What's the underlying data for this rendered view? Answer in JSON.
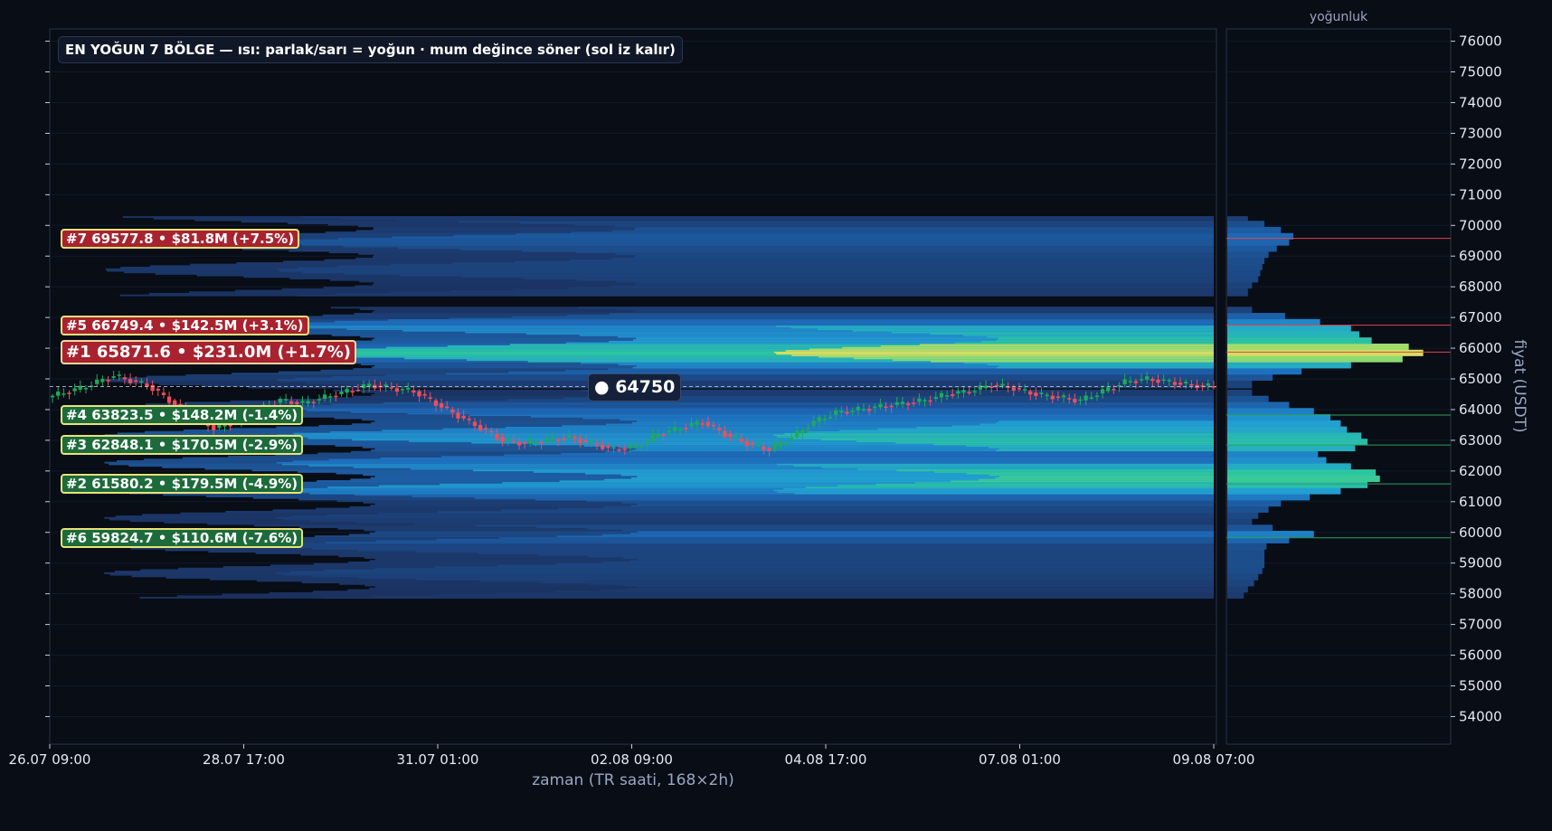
{
  "chart_title": "EN YOĞUN 7 BÖLGE — ısı: parlak/sarı = yoğun · mum değince söner (sol iz kalır)",
  "profile_title": "yoğunluk",
  "current_price_label": "● 64750",
  "colors": {
    "background": "#080d16",
    "bull_candle": "#1faa59",
    "bear_candle": "#ef4e5c",
    "heat_low": "#1b2c58",
    "heat_mid": "#1e8fd0",
    "heat_high": "#2cc7a0",
    "heat_top": "#f3e05a",
    "label_red": "#a8232f",
    "label_green": "#1d6b3a"
  },
  "zone_labels": [
    {
      "rank": "#7",
      "text": "#7  69577.8  •  $81.8M  (+7.5%)",
      "color": "red"
    },
    {
      "rank": "#5",
      "text": "#5  66749.4  •  $142.5M  (+3.1%)",
      "color": "red"
    },
    {
      "rank": "#1",
      "text": "#1  65871.6  •  $231.0M  (+1.7%)",
      "color": "red"
    },
    {
      "rank": "#4",
      "text": "#4  63823.5  •  $148.2M  (-1.4%)",
      "color": "green"
    },
    {
      "rank": "#3",
      "text": "#3  62848.1  •  $170.5M  (-2.9%)",
      "color": "green"
    },
    {
      "rank": "#2",
      "text": "#2  61580.2  •  $179.5M  (-4.9%)",
      "color": "green"
    },
    {
      "rank": "#6",
      "text": "#6  59824.7  •  $110.6M  (-7.6%)",
      "color": "green"
    }
  ],
  "chart_data": {
    "type": "heatmap",
    "title": "EN YOĞUN 7 BÖLGE — ısı: parlak/sarı = yoğun · mum değince söner (sol iz kalır)",
    "xlabel": "zaman (TR saati, 168×2h)",
    "ylabel": "fiyat (USDT)",
    "x_ticks": [
      "26.07 09:00",
      "28.07 17:00",
      "31.07 01:00",
      "02.08 09:00",
      "04.08 17:00",
      "07.08 01:00",
      "09.08 07:00"
    ],
    "y_ticks": [
      "54000",
      "55000",
      "56000",
      "57000",
      "58000",
      "59000",
      "60000",
      "61000",
      "62000",
      "63000",
      "64000",
      "65000",
      "66000",
      "67000",
      "68000",
      "69000",
      "70000",
      "71000",
      "72000",
      "73000",
      "74000",
      "75000",
      "76000"
    ],
    "ylim": [
      53100,
      76400
    ],
    "candle_count": 168,
    "current_price": 64750,
    "zones": [
      {
        "rank": 7,
        "price": 69577.8,
        "liquidity_musd": 81.8,
        "change_pct": 7.5
      },
      {
        "rank": 5,
        "price": 66749.4,
        "liquidity_musd": 142.5,
        "change_pct": 3.1
      },
      {
        "rank": 1,
        "price": 65871.6,
        "liquidity_musd": 231.0,
        "change_pct": 1.7
      },
      {
        "rank": 4,
        "price": 63823.5,
        "liquidity_musd": 148.2,
        "change_pct": -1.4
      },
      {
        "rank": 3,
        "price": 62848.1,
        "liquidity_musd": 170.5,
        "change_pct": -2.9
      },
      {
        "rank": 2,
        "price": 61580.2,
        "liquidity_musd": 179.5,
        "change_pct": -4.9
      },
      {
        "rank": 6,
        "price": 59824.7,
        "liquidity_musd": 110.6,
        "change_pct": -7.6
      }
    ],
    "price_path": [
      [
        0,
        64400
      ],
      [
        6,
        64700
      ],
      [
        12,
        65100
      ],
      [
        18,
        64800
      ],
      [
        22,
        64300
      ],
      [
        26,
        63800
      ],
      [
        30,
        63400
      ],
      [
        34,
        63600
      ],
      [
        38,
        64000
      ],
      [
        42,
        64300
      ],
      [
        46,
        64200
      ],
      [
        50,
        64400
      ],
      [
        54,
        64600
      ],
      [
        58,
        64800
      ],
      [
        62,
        64700
      ],
      [
        66,
        64600
      ],
      [
        70,
        64200
      ],
      [
        74,
        63800
      ],
      [
        78,
        63400
      ],
      [
        82,
        63000
      ],
      [
        86,
        62900
      ],
      [
        90,
        63000
      ],
      [
        94,
        63100
      ],
      [
        98,
        62900
      ],
      [
        102,
        62700
      ],
      [
        106,
        62800
      ],
      [
        110,
        63200
      ],
      [
        114,
        63400
      ],
      [
        118,
        63600
      ],
      [
        122,
        63200
      ],
      [
        126,
        62900
      ],
      [
        130,
        62700
      ],
      [
        134,
        63100
      ],
      [
        138,
        63600
      ],
      [
        142,
        63900
      ],
      [
        146,
        64000
      ],
      [
        150,
        64100
      ],
      [
        154,
        64200
      ],
      [
        158,
        64300
      ],
      [
        162,
        64500
      ],
      [
        166,
        64600
      ],
      [
        170,
        64800
      ],
      [
        174,
        64700
      ],
      [
        178,
        64500
      ],
      [
        182,
        64400
      ],
      [
        186,
        64300
      ],
      [
        190,
        64600
      ],
      [
        194,
        64900
      ],
      [
        198,
        65000
      ],
      [
        202,
        64900
      ],
      [
        206,
        64800
      ],
      [
        210,
        64750
      ]
    ],
    "density_profile": [
      [
        57900,
        0.08
      ],
      [
        58100,
        0.1
      ],
      [
        58300,
        0.13
      ],
      [
        58500,
        0.15
      ],
      [
        58700,
        0.17
      ],
      [
        58900,
        0.18
      ],
      [
        59100,
        0.18
      ],
      [
        59300,
        0.18
      ],
      [
        59500,
        0.19
      ],
      [
        59700,
        0.3
      ],
      [
        59900,
        0.42
      ],
      [
        60100,
        0.22
      ],
      [
        60300,
        0.12
      ],
      [
        60500,
        0.15
      ],
      [
        60700,
        0.2
      ],
      [
        60900,
        0.26
      ],
      [
        61100,
        0.4
      ],
      [
        61300,
        0.55
      ],
      [
        61500,
        0.68
      ],
      [
        61700,
        0.74
      ],
      [
        61900,
        0.72
      ],
      [
        62100,
        0.6
      ],
      [
        62300,
        0.48
      ],
      [
        62500,
        0.44
      ],
      [
        62700,
        0.62
      ],
      [
        62900,
        0.68
      ],
      [
        63100,
        0.65
      ],
      [
        63300,
        0.58
      ],
      [
        63500,
        0.55
      ],
      [
        63700,
        0.5
      ],
      [
        63900,
        0.42
      ],
      [
        64100,
        0.3
      ],
      [
        64300,
        0.2
      ],
      [
        64500,
        0.12
      ],
      [
        64800,
        0.12
      ],
      [
        65000,
        0.22
      ],
      [
        65200,
        0.36
      ],
      [
        65400,
        0.6
      ],
      [
        65600,
        0.85
      ],
      [
        65800,
        0.95
      ],
      [
        66000,
        0.88
      ],
      [
        66200,
        0.7
      ],
      [
        66400,
        0.64
      ],
      [
        66600,
        0.6
      ],
      [
        66800,
        0.45
      ],
      [
        67000,
        0.28
      ],
      [
        67200,
        0.12
      ],
      [
        67800,
        0.1
      ],
      [
        68000,
        0.12
      ],
      [
        68200,
        0.15
      ],
      [
        68400,
        0.16
      ],
      [
        68600,
        0.17
      ],
      [
        68800,
        0.18
      ],
      [
        69000,
        0.2
      ],
      [
        69200,
        0.24
      ],
      [
        69400,
        0.3
      ],
      [
        69600,
        0.32
      ],
      [
        69800,
        0.26
      ],
      [
        70000,
        0.18
      ],
      [
        70200,
        0.1
      ]
    ]
  }
}
